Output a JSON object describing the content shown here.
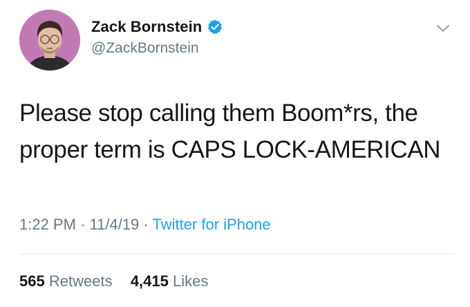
{
  "author": {
    "display_name": "Zack Bornstein",
    "handle": "@ZackBornstein",
    "verified": true,
    "avatar_icon": "profile-photo"
  },
  "tweet": {
    "lines": [
      "Please stop calling them Boom*rs, the",
      "proper term is CAPS LOCK-AMERICAN"
    ]
  },
  "meta": {
    "time": "1:22 PM",
    "separator": "·",
    "date": "11/4/19",
    "source": "Twitter for iPhone"
  },
  "stats": {
    "retweets_count": "565",
    "retweets_label": "Retweets",
    "likes_count": "4,415",
    "likes_label": "Likes"
  },
  "colors": {
    "text": "#14171a",
    "secondary": "#657786",
    "link": "#1da1f2",
    "verified_badge": "#1da1f2",
    "avatar_bg": "#b96fae"
  }
}
